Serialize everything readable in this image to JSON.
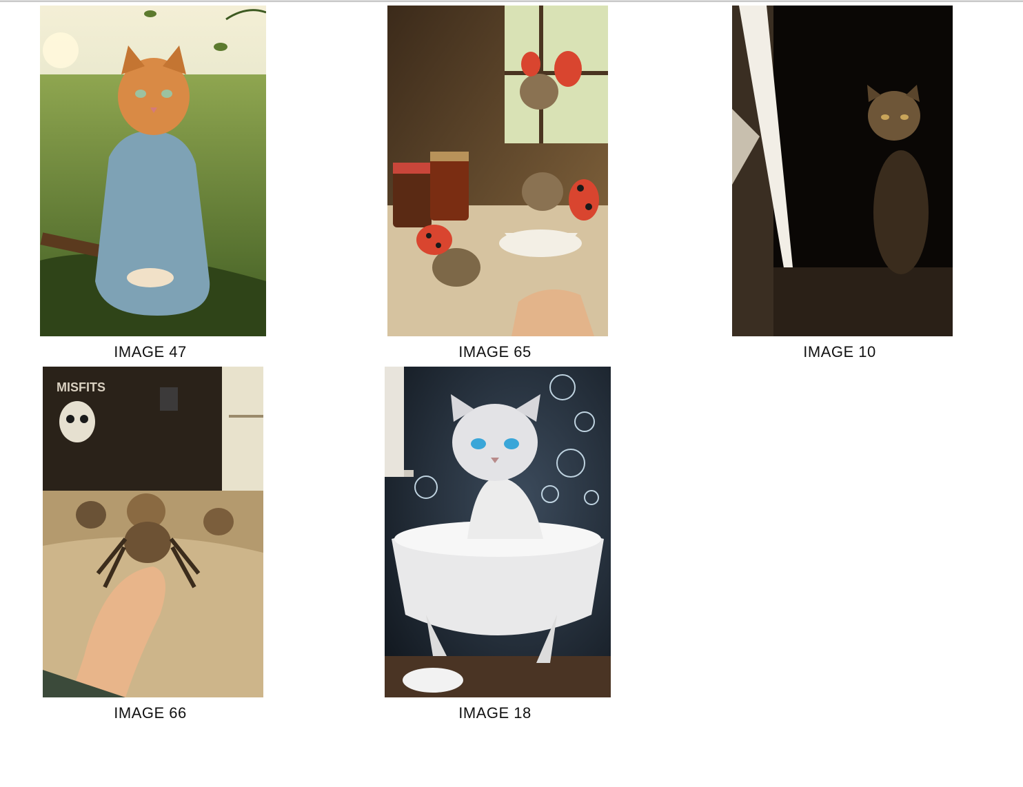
{
  "gallery": {
    "items": [
      {
        "caption": "IMAGE 47",
        "icon": "cat-in-blue-dress-image"
      },
      {
        "caption": "IMAGE 65",
        "icon": "ladybug-kittens-image"
      },
      {
        "caption": "IMAGE 10",
        "icon": "tabby-cat-doorway-image"
      },
      {
        "caption": "IMAGE 66",
        "icon": "spider-kittens-image"
      },
      {
        "caption": "IMAGE 18",
        "icon": "bubble-cat-bathtub-image"
      }
    ],
    "poster_text": "MISFITS"
  },
  "colors": {
    "background": "#ffffff",
    "caption_text": "#111111",
    "top_rule": "#d8d8d8"
  }
}
